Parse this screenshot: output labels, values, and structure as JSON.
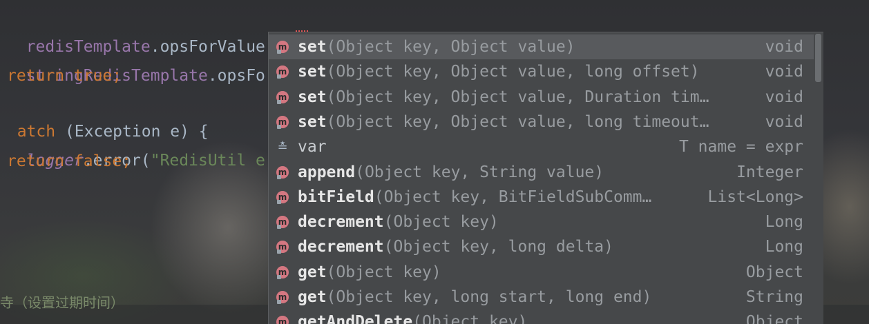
{
  "editor": {
    "lines": [
      {
        "parts": [
          "redisTemplate",
          ".opsForValue()."
        ]
      },
      {
        "parts": [
          "stringRedisTemplate",
          ".opsFo"
        ]
      },
      {
        "parts": [
          "return true;"
        ]
      },
      {
        "parts": [
          "atch",
          " (Exception e) {"
        ]
      },
      {
        "parts": [
          "logger",
          ".error(",
          "\"RedisUtil e"
        ]
      },
      {
        "parts": [
          "return false;"
        ]
      }
    ],
    "comment_fragment": "寺（设置过期时间）"
  },
  "completion": {
    "items": [
      {
        "name": "set",
        "params": "(Object key, Object value)",
        "return_type": "void",
        "icon": "method-icon",
        "selected": true
      },
      {
        "name": "set",
        "params": "(Object key, Object value, long offset)",
        "return_type": "void",
        "icon": "method-icon"
      },
      {
        "name": "set",
        "params": "(Object key, Object value, Duration tim…",
        "return_type": "void",
        "icon": "method-icon"
      },
      {
        "name": "set",
        "params": "(Object key, Object value, long timeout…",
        "return_type": "void",
        "icon": "method-icon"
      },
      {
        "name": "var",
        "params": "",
        "return_type": "T name = expr",
        "icon": "postfix-template-icon"
      },
      {
        "name": "append",
        "params": "(Object key, String value)",
        "return_type": "Integer",
        "icon": "method-icon"
      },
      {
        "name": "bitField",
        "params": "(Object key, BitFieldSubComm…",
        "return_type": "List<Long>",
        "icon": "method-icon"
      },
      {
        "name": "decrement",
        "params": "(Object key)",
        "return_type": "Long",
        "icon": "method-icon"
      },
      {
        "name": "decrement",
        "params": "(Object key, long delta)",
        "return_type": "Long",
        "icon": "method-icon"
      },
      {
        "name": "get",
        "params": "(Object key)",
        "return_type": "Object",
        "icon": "method-icon"
      },
      {
        "name": "get",
        "params": "(Object key, long start, long end)",
        "return_type": "String",
        "icon": "method-icon"
      },
      {
        "name": "getAndDelete",
        "params": "(Object key)",
        "return_type": "Object",
        "icon": "method-icon"
      }
    ],
    "method_icon_glyph": "m",
    "var_icon_glyph": "≛"
  }
}
